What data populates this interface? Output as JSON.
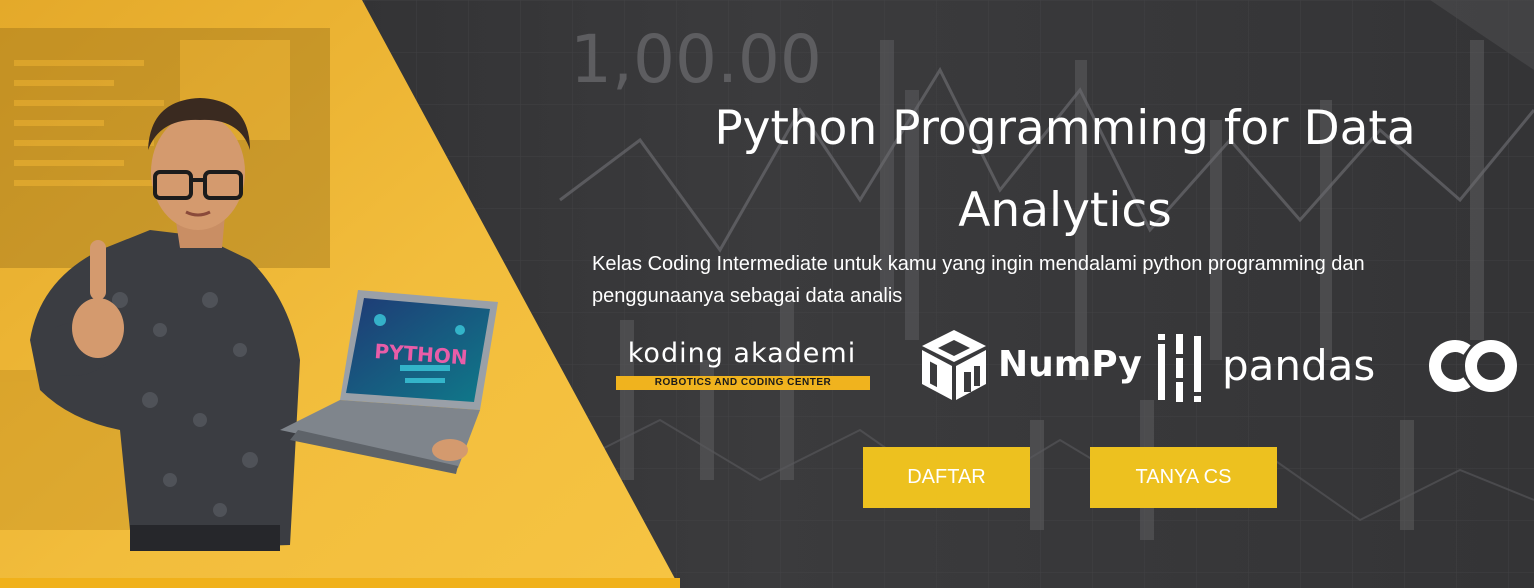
{
  "hero": {
    "title": "Python Programming for Data Analytics",
    "subtitle": "Kelas Coding Intermediate untuk kamu yang ingin mendalami python programming dan penggunaanya sebagai data analis"
  },
  "logos": {
    "coding_akademi": {
      "name": "koding akademi",
      "tagline": "ROBOTICS AND CODING CENTER"
    },
    "numpy": {
      "name": "NumPy"
    },
    "pandas": {
      "name": "pandas"
    },
    "colab": {
      "name": "CO"
    }
  },
  "background": {
    "chart_text": "1,00.00",
    "laptop_screen_text": "PYTHON"
  },
  "buttons": {
    "daftar_label": "DAFTAR",
    "tanya_cs_label": "TANYA CS"
  },
  "colors": {
    "accent_yellow": "#f0b31e",
    "button_yellow": "#edc11f",
    "dark_background": "#39393b",
    "text_white": "#ffffff"
  }
}
